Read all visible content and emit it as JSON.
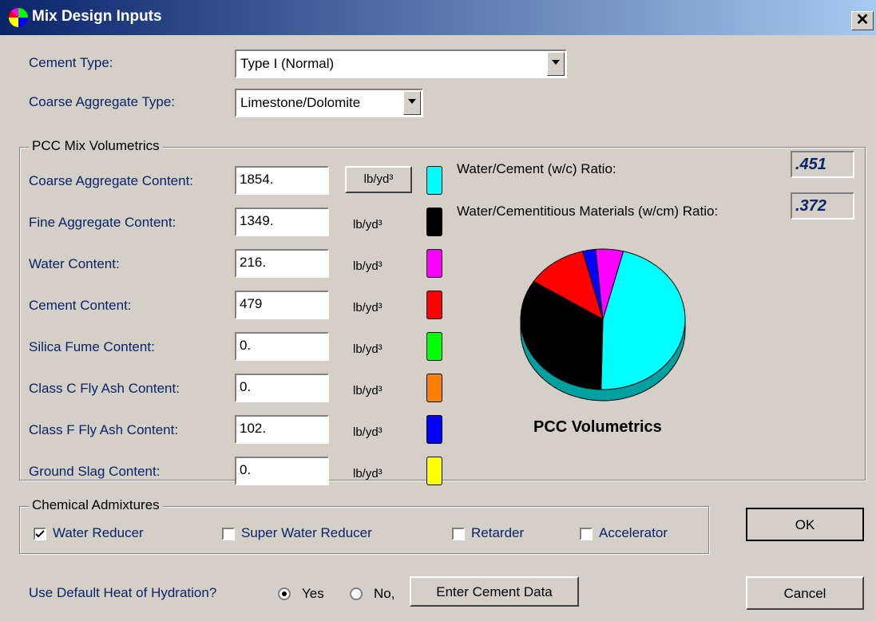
{
  "window": {
    "title": "Mix Design Inputs",
    "close_glyph": "✕"
  },
  "cement_type": {
    "label": "Cement Type:",
    "value": "Type I (Normal)"
  },
  "coarse_aggregate_type": {
    "label": "Coarse Aggregate Type:",
    "value": "Limestone/Dolomite"
  },
  "volumetrics": {
    "group_title": "PCC Mix Volumetrics",
    "unit_button": "lb/yd³",
    "rows": [
      {
        "label": "Coarse Aggregate Content:",
        "value": "1854.",
        "unit": "lb/yd³",
        "color": "#00ffff"
      },
      {
        "label": "Fine Aggregate Content:",
        "value": "1349.",
        "unit": "lb/yd³",
        "color": "#000000"
      },
      {
        "label": "Water Content:",
        "value": "216.",
        "unit": "lb/yd³",
        "color": "#ff00ff"
      },
      {
        "label": "Cement Content:",
        "value": "479",
        "unit": "lb/yd³",
        "color": "#ff0000"
      },
      {
        "label": "Silica Fume Content:",
        "value": "0.",
        "unit": "lb/yd³",
        "color": "#00ff00"
      },
      {
        "label": "Class C Fly Ash Content:",
        "value": "0.",
        "unit": "lb/yd³",
        "color": "#ff8000"
      },
      {
        "label": "Class F Fly Ash Content:",
        "value": "102.",
        "unit": "lb/yd³",
        "color": "#0000ff"
      },
      {
        "label": "Ground Slag Content:",
        "value": "0.",
        "unit": "lb/yd³",
        "color": "#ffff00"
      }
    ],
    "wc_label": "Water/Cement (w/c) Ratio:",
    "wc_value": ".451",
    "wcm_label": "Water/Cementitious Materials (w/cm) Ratio:",
    "wcm_value": ".372"
  },
  "chart_data": {
    "type": "pie",
    "title": "PCC Volumetrics",
    "slices": [
      {
        "value": 1854,
        "color": "#00ffff"
      },
      {
        "value": 1349,
        "color": "#000000"
      },
      {
        "value": 479,
        "color": "#ff0000"
      },
      {
        "value": 102,
        "color": "#0000ff"
      },
      {
        "value": 216,
        "color": "#ff00ff"
      }
    ],
    "side_color": "#00a0a0"
  },
  "admixtures": {
    "group_title": "Chemical Admixtures",
    "items": [
      {
        "label": "Water Reducer",
        "checked": true
      },
      {
        "label": "Super Water Reducer",
        "checked": false
      },
      {
        "label": "Retarder",
        "checked": false
      },
      {
        "label": "Accelerator",
        "checked": false
      }
    ]
  },
  "heat": {
    "label": "Use Default Heat of Hydration?",
    "yes_label": "Yes",
    "no_label": "No,",
    "enter_button": "Enter Cement Data"
  },
  "buttons": {
    "ok": "OK",
    "cancel": "Cancel"
  }
}
